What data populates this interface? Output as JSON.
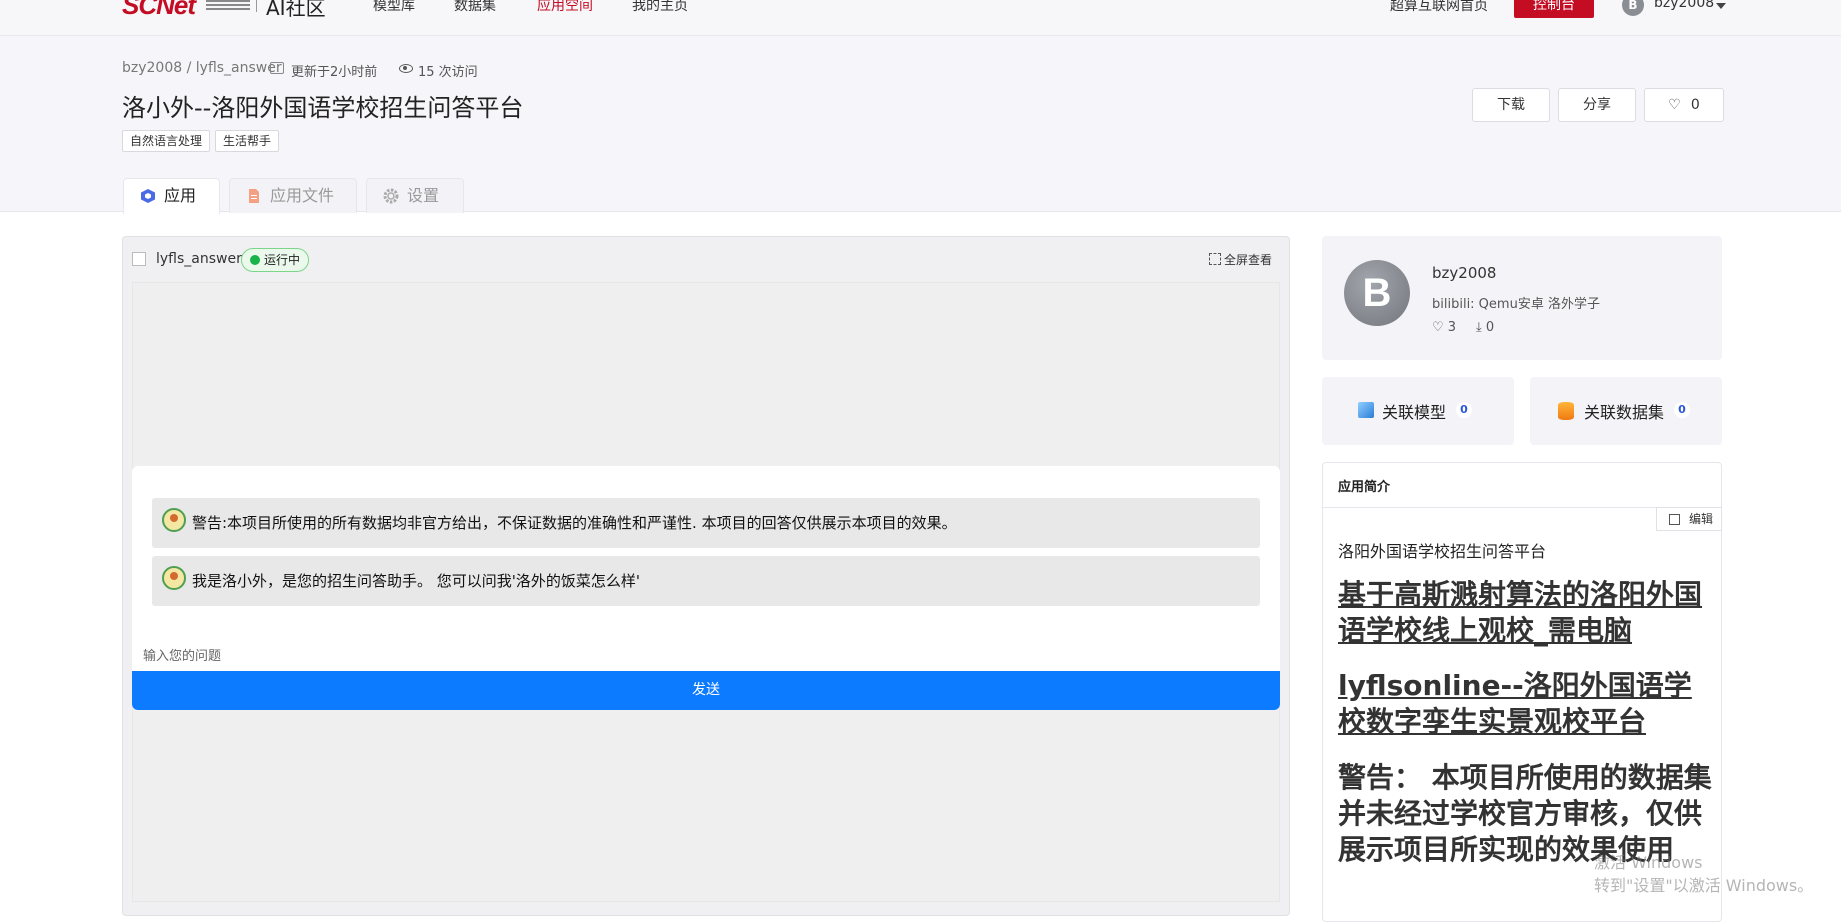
{
  "nav": {
    "logo": "SCNet",
    "community": "AI社区",
    "items": [
      "模型库",
      "数据集",
      "应用空间",
      "我的主页"
    ],
    "active_index": 2,
    "supercomputing_home": "超算互联网首页",
    "console": "控制台",
    "user_initial": "B",
    "username": "bzy2008"
  },
  "header": {
    "breadcrumb": "bzy2008 / lyfls_answer",
    "updated": "更新于2小时前",
    "visits": "15 次访问",
    "title": "洛小外--洛阳外国语学校招生问答平台",
    "tags": [
      "自然语言处理",
      "生活帮手"
    ],
    "download": "下载",
    "share": "分享",
    "likes": "0"
  },
  "tabs": [
    "应用",
    "应用文件",
    "设置"
  ],
  "app": {
    "name": "lyfls_answer",
    "status": "运行中",
    "fullscreen": "全屏查看",
    "messages": [
      "警告:本项目所使用的所有数据均非官方给出，不保证数据的准确性和严谨性. 本项目的回答仅供展示本项目的效果。",
      "我是洛小外，是您的招生问答助手。 您可以问我'洛外的饭菜怎么样'"
    ],
    "input_label": "输入您的问题",
    "send": "发送"
  },
  "author": {
    "initial": "B",
    "name": "bzy2008",
    "bio": "bilibili: Qemu安卓 洛外学子",
    "likes": "3",
    "downloads": "0"
  },
  "related": {
    "model_label": "关联模型",
    "model_count": "0",
    "dataset_label": "关联数据集",
    "dataset_count": "0"
  },
  "intro": {
    "heading": "应用简介",
    "edit": "编辑",
    "subtitle": "洛阳外国语学校招生问答平台",
    "link1": "基于高斯溅射算法的洛阳外国语学校线上观校_需电脑",
    "link2": "lyflsonline--洛阳外国语学校数字孪生实景观校平台",
    "warning": "警告： 本项目所使用的数据集并未经过学校官方审核，仅供展示项目所实现的效果使用"
  },
  "watermark": {
    "line1": "激活 Windows",
    "line2": "转到\"设置\"以激活 Windows。"
  }
}
